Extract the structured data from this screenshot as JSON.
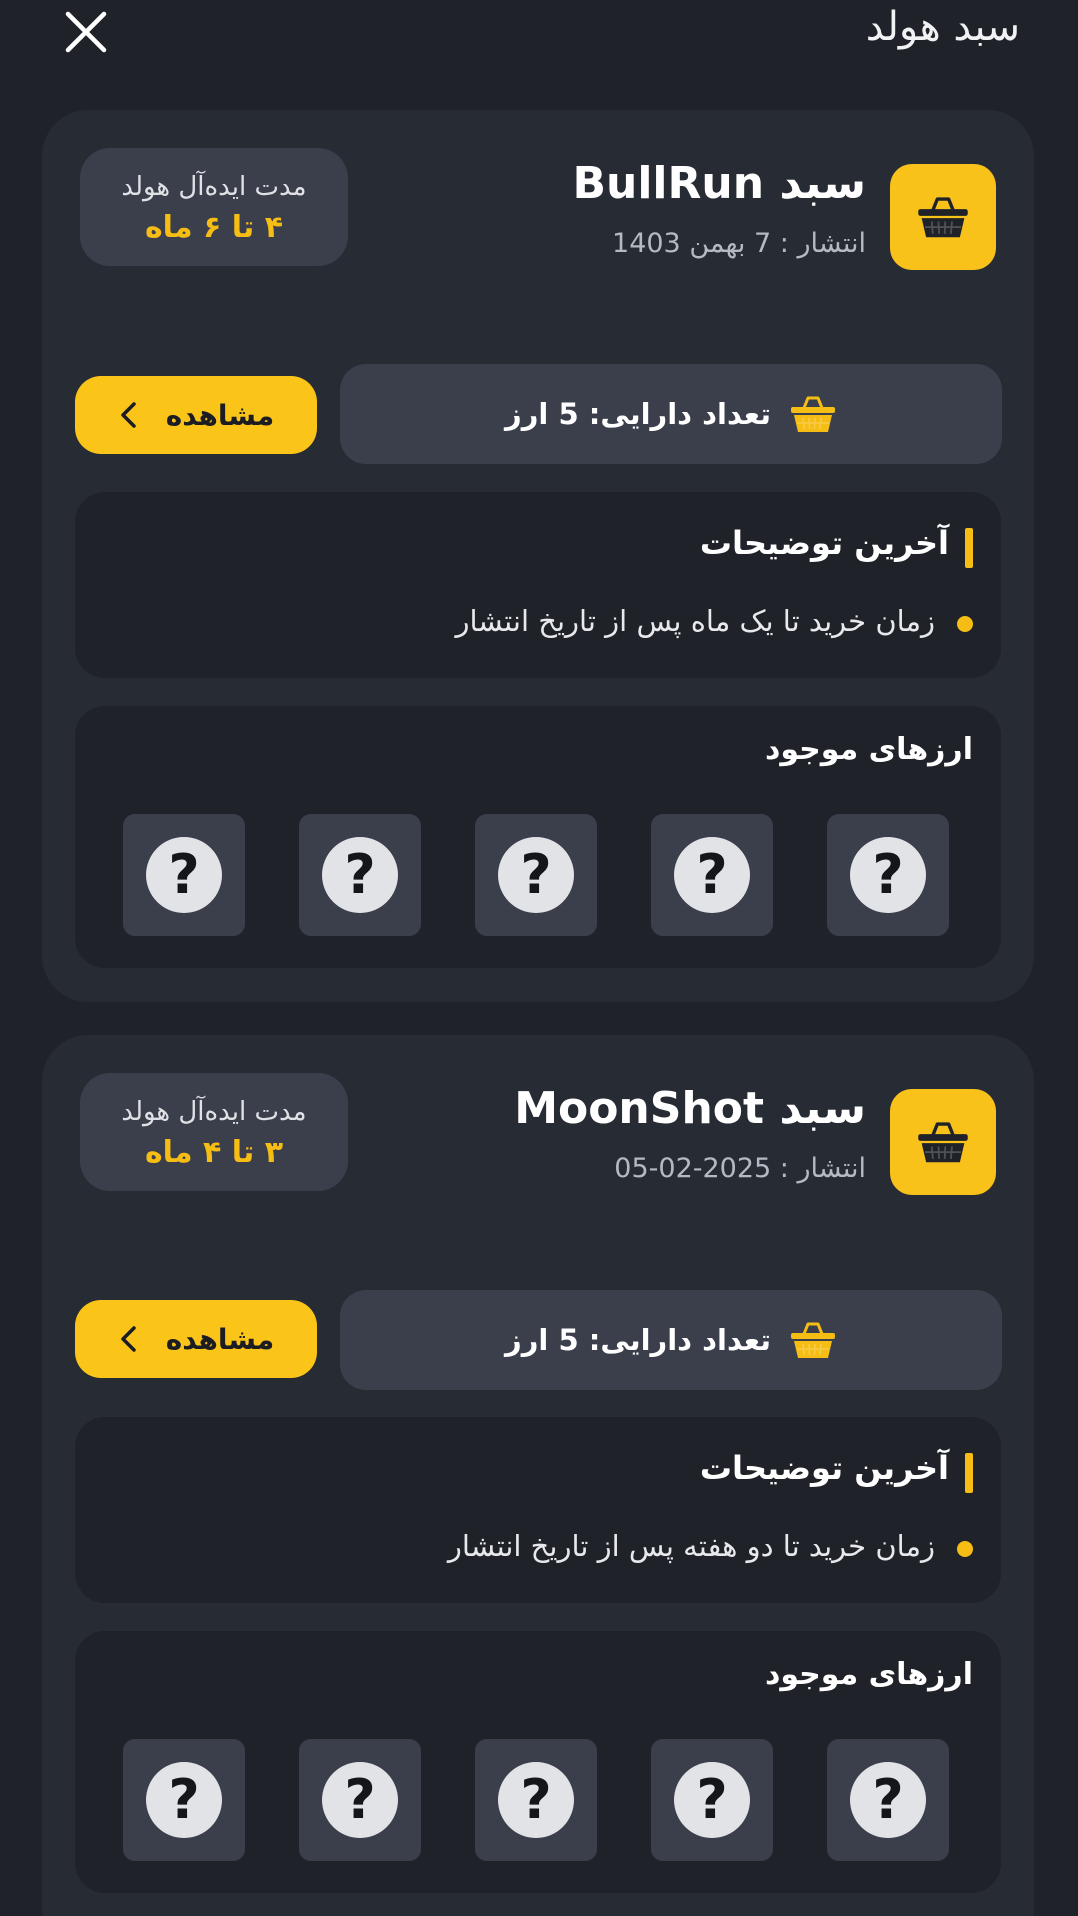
{
  "header": {
    "title": "سبد هولد",
    "close_icon": "close-icon"
  },
  "colors": {
    "background": "#1f2229",
    "card": "#272b34",
    "surface": "#3a3f4b",
    "accent": "#f9c21a",
    "accent_text": "#f6bd14"
  },
  "baskets": [
    {
      "title": "سبد BullRun",
      "published": "انتشار : 7 بهمن 1403",
      "hold_label": "مدت ایده‌آل هولد",
      "hold_value": "۴ تا ۶ ماه",
      "asset_count": "تعداد دارایی: 5 ارز",
      "view_label": "مشاهده",
      "notes_title": "آخرین توضیحات",
      "notes": [
        "زمان خرید تا یک ماه پس از تاریخ انتشار"
      ],
      "coins_title": "ارزهای موجود",
      "coins": [
        "?",
        "?",
        "?",
        "?",
        "?"
      ]
    },
    {
      "title": "سبد MoonShot",
      "published": "انتشار : 2025-02-05",
      "hold_label": "مدت ایده‌آل هولد",
      "hold_value": "۳ تا ۴ ماه",
      "asset_count": "تعداد دارایی: 5 ارز",
      "view_label": "مشاهده",
      "notes_title": "آخرین توضیحات",
      "notes": [
        "زمان خرید تا دو هفته پس از تاریخ انتشار"
      ],
      "coins_title": "ارزهای موجود",
      "coins": [
        "?",
        "?",
        "?",
        "?",
        "?"
      ]
    }
  ]
}
